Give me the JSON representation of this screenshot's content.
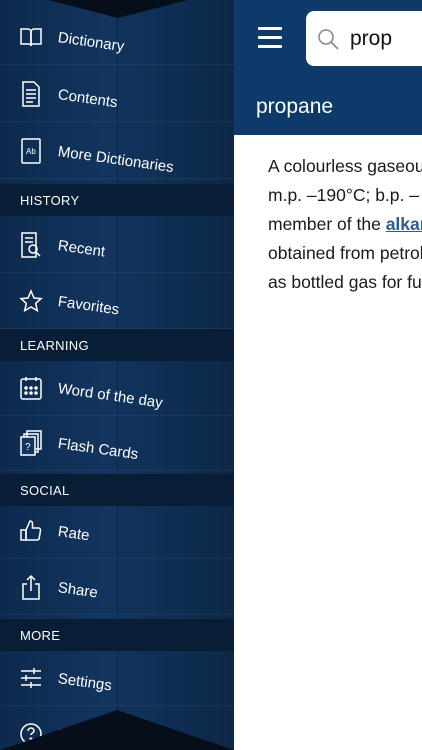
{
  "drawer": {
    "items_main": [
      {
        "label": "Dictionary",
        "icon": "book-icon"
      },
      {
        "label": "Contents",
        "icon": "document-icon"
      },
      {
        "label": "More Dictionaries",
        "icon": "ab-book-icon"
      }
    ],
    "history": {
      "header": "HISTORY",
      "items": [
        {
          "label": "Recent",
          "icon": "recent-icon"
        },
        {
          "label": "Favorites",
          "icon": "star-icon"
        }
      ]
    },
    "learning": {
      "header": "LEARNING",
      "items": [
        {
          "label": "Word of the day",
          "icon": "calendar-icon"
        },
        {
          "label": "Flash Cards",
          "icon": "flash-cards-icon"
        }
      ]
    },
    "social": {
      "header": "SOCIAL",
      "items": [
        {
          "label": "Rate",
          "icon": "thumbs-up-icon"
        },
        {
          "label": "Share",
          "icon": "share-icon"
        }
      ]
    },
    "more": {
      "header": "MORE",
      "items": [
        {
          "label": "Settings",
          "icon": "sliders-icon"
        },
        {
          "label": "Help",
          "icon": "help-icon"
        }
      ]
    }
  },
  "main": {
    "search_value": "prop",
    "entry_title": "propane",
    "definition_lines": [
      "A colourless gaseous",
      "m.p. –190°C; b.p. –",
      "member of the ",
      "obtained from petroleum",
      "as bottled gas for fuel"
    ],
    "definition_link": "alkane"
  },
  "colors": {
    "drawer_bg": "#12345e",
    "header_bg": "#0e3a69",
    "link": "#2a5e93"
  }
}
